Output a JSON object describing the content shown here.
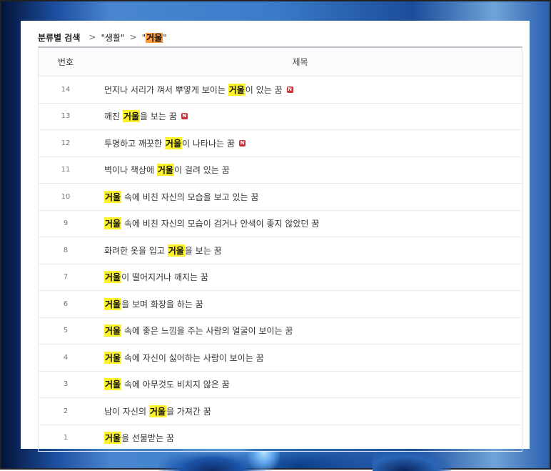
{
  "breadcrumb": {
    "root": "분류별 검색",
    "sep": ">",
    "category": "\"생활\"",
    "keyword_quote_open": "\"",
    "keyword": "거울",
    "keyword_quote_close": "\""
  },
  "table": {
    "headers": {
      "number": "번호",
      "title": "제목"
    },
    "rows": [
      {
        "number": "14",
        "before": "먼지나 서리가 껴서 뿌옇게 보이는 ",
        "keyword": "거울",
        "after": "이 있는 꿈",
        "new_badge": "N",
        "is_new": true
      },
      {
        "number": "13",
        "before": "깨진 ",
        "keyword": "거울",
        "after": "을 보는 꿈",
        "new_badge": "N",
        "is_new": true
      },
      {
        "number": "12",
        "before": "투명하고 깨끗한 ",
        "keyword": "거울",
        "after": "이 나타나는 꿈",
        "new_badge": "N",
        "is_new": true
      },
      {
        "number": "11",
        "before": "벽이나 책상에 ",
        "keyword": "거울",
        "after": "이 걸려 있는 꿈",
        "is_new": false
      },
      {
        "number": "10",
        "before": "",
        "keyword": "거울",
        "after": " 속에 비친 자신의 모습을 보고 있는 꿈",
        "is_new": false
      },
      {
        "number": "9",
        "before": "",
        "keyword": "거울",
        "after": " 속에 비친 자신의 모습이 검거나 안색이 좋지 않았던 꿈",
        "is_new": false
      },
      {
        "number": "8",
        "before": "화려한 옷을 입고 ",
        "keyword": "거울",
        "after": "을 보는 꿈",
        "is_new": false
      },
      {
        "number": "7",
        "before": "",
        "keyword": "거울",
        "after": "이 떨어지거나 깨지는 꿈",
        "is_new": false
      },
      {
        "number": "6",
        "before": "",
        "keyword": "거울",
        "after": "을 보며 화장을 하는 꿈",
        "is_new": false
      },
      {
        "number": "5",
        "before": "",
        "keyword": "거울",
        "after": " 속에 좋은 느낌을 주는 사람의 얼굴이 보이는 꿈",
        "is_new": false
      },
      {
        "number": "4",
        "before": "",
        "keyword": "거울",
        "after": " 속에 자신이 싫어하는 사람이 보이는 꿈",
        "is_new": false
      },
      {
        "number": "3",
        "before": "",
        "keyword": "거울",
        "after": " 속에 아무것도 비치지 않은 꿈",
        "is_new": false
      },
      {
        "number": "2",
        "before": "남이 자신의 ",
        "keyword": "거울",
        "after": "을 가져간 꿈",
        "is_new": false
      },
      {
        "number": "1",
        "before": "",
        "keyword": "거울",
        "after": "을 선물받는 꿈",
        "is_new": false
      }
    ]
  },
  "colors": {
    "highlight": "#fbf22a",
    "keyword_breadcrumb_highlight": "#f79a3c",
    "new_badge": "#c8343a"
  }
}
